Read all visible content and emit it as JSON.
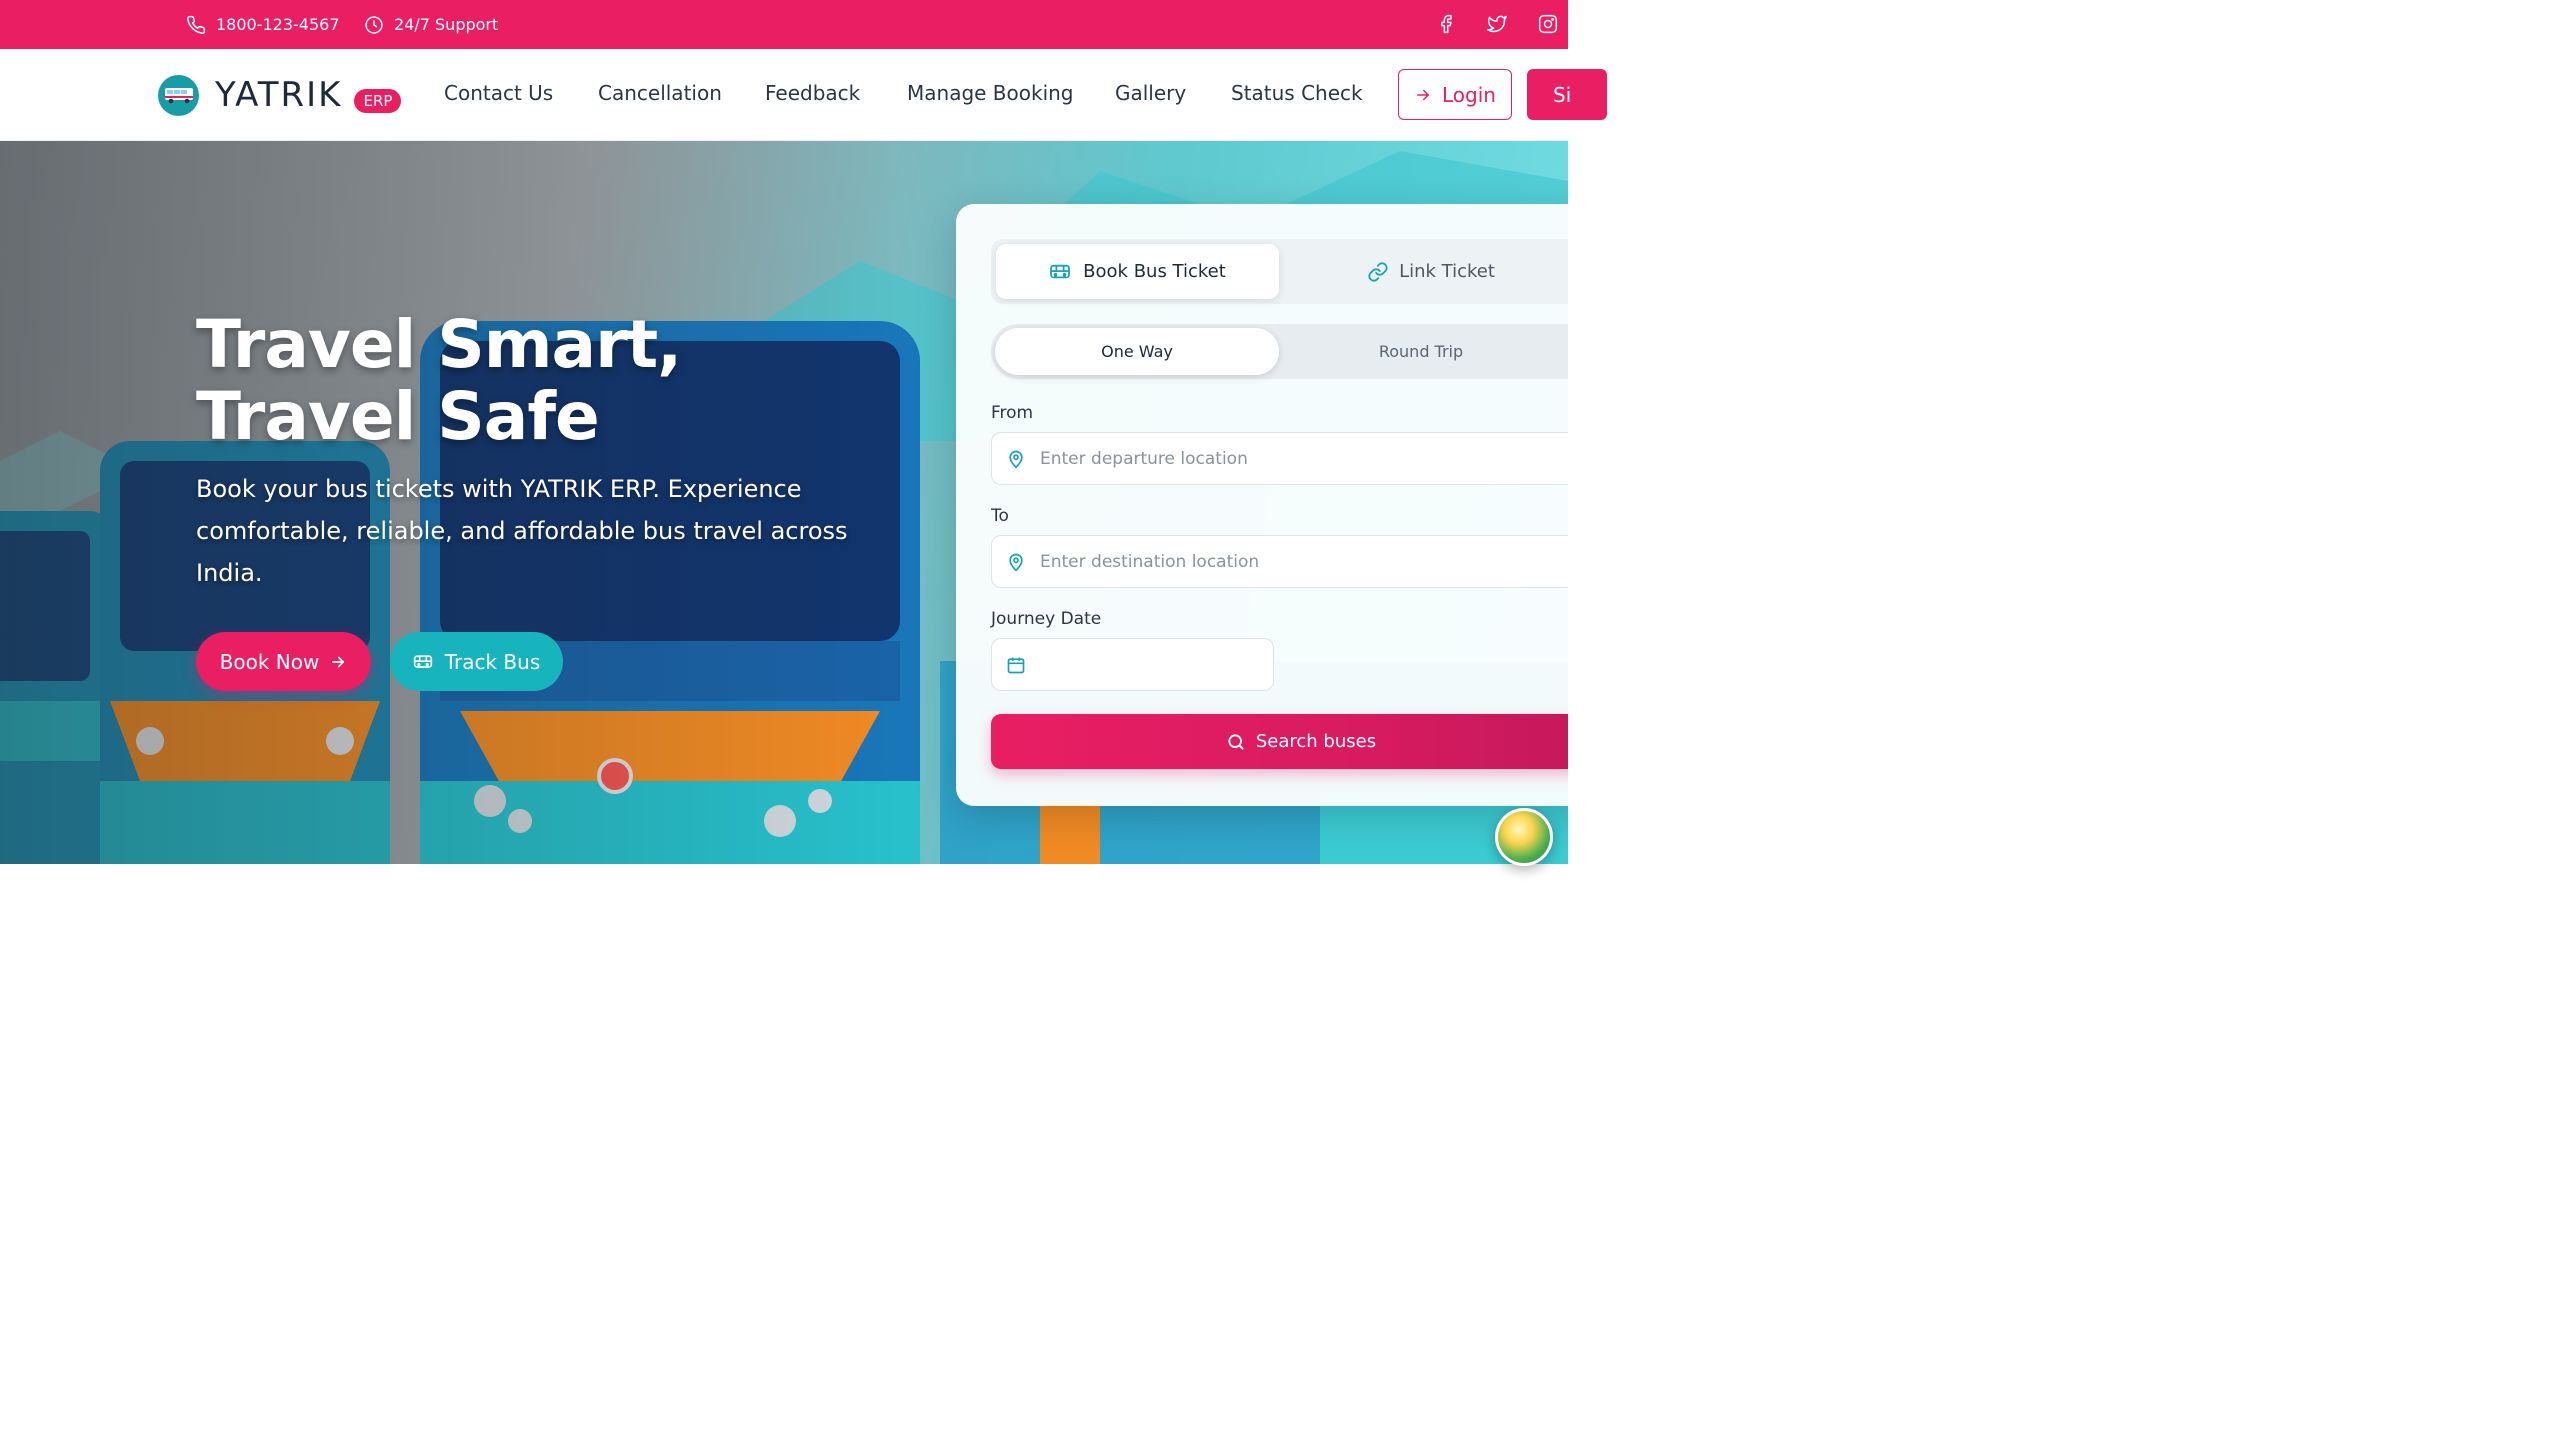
{
  "topbar": {
    "phone": "1800-123-4567",
    "support": "24/7 Support",
    "social": [
      "facebook-icon",
      "twitter-icon",
      "instagram-icon"
    ]
  },
  "nav": {
    "brand": "YATRIK",
    "badge": "ERP",
    "links": [
      "Contact Us",
      "Cancellation",
      "Feedback",
      "Manage Booking",
      "Gallery",
      "Status Check"
    ],
    "login": "Login",
    "signup": "Si"
  },
  "hero": {
    "title_line1": "Travel Smart,",
    "title_line2": "Travel Safe",
    "subtitle": "Book your bus tickets with YATRIK ERP. Experience comfortable, reliable, and affordable bus travel across India.",
    "book_now": "Book Now",
    "track_bus": "Track Bus"
  },
  "booking": {
    "tab_book": "Book Bus Ticket",
    "tab_link": "Link Ticket",
    "trip_one_way": "One Way",
    "trip_round": "Round Trip",
    "from_label": "From",
    "from_placeholder": "Enter departure location",
    "to_label": "To",
    "to_placeholder": "Enter destination location",
    "date_label": "Journey Date",
    "date_value": "",
    "search": "Search buses"
  },
  "colors": {
    "primary": "#e91e63",
    "teal": "#17b4bd",
    "dark": "#1e2a3a"
  }
}
